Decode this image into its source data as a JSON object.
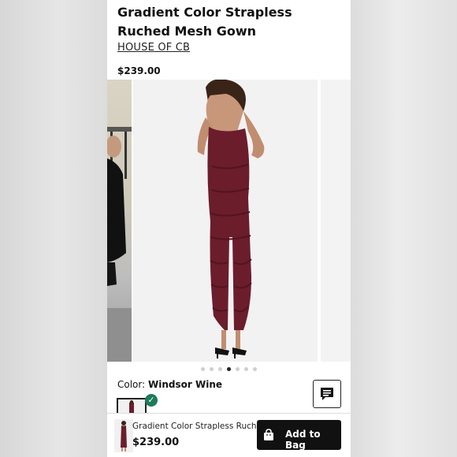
{
  "product": {
    "title": "Gradient Color Strapless Ruched Mesh Gown",
    "brand": "HOUSE OF CB",
    "price": "$239.00"
  },
  "carousel": {
    "total_dots": 7,
    "active_index": 3
  },
  "color": {
    "label": "Color:",
    "value": "Windsor Wine",
    "accent": "#6b1d2c"
  },
  "bottom_bar": {
    "title": "Gradient Color Strapless Ruch...",
    "price": "$239.00",
    "add_label": "Add to Bag"
  },
  "icons": {
    "chat": "chat-icon",
    "bag": "shopping-bag-icon",
    "check": "check-icon"
  }
}
